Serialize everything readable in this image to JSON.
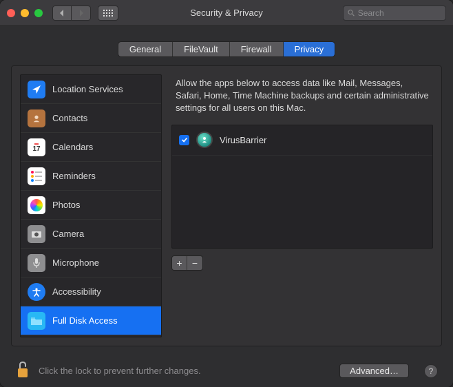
{
  "window": {
    "title": "Security & Privacy"
  },
  "search": {
    "placeholder": "Search"
  },
  "tabs": [
    {
      "label": "General",
      "active": false
    },
    {
      "label": "FileVault",
      "active": false
    },
    {
      "label": "Firewall",
      "active": false
    },
    {
      "label": "Privacy",
      "active": true
    }
  ],
  "sidebar": {
    "items": [
      {
        "label": "Location Services",
        "icon": "location",
        "selected": false
      },
      {
        "label": "Contacts",
        "icon": "contacts",
        "selected": false
      },
      {
        "label": "Calendars",
        "icon": "calendar",
        "selected": false
      },
      {
        "label": "Reminders",
        "icon": "reminders",
        "selected": false
      },
      {
        "label": "Photos",
        "icon": "photos",
        "selected": false
      },
      {
        "label": "Camera",
        "icon": "camera",
        "selected": false
      },
      {
        "label": "Microphone",
        "icon": "microphone",
        "selected": false
      },
      {
        "label": "Accessibility",
        "icon": "accessibility",
        "selected": false
      },
      {
        "label": "Full Disk Access",
        "icon": "folder",
        "selected": true
      }
    ]
  },
  "content": {
    "description": "Allow the apps below to access data like Mail, Messages, Safari, Home, Time Machine backups and certain administrative settings for all users on this Mac.",
    "apps": [
      {
        "name": "VirusBarrier",
        "checked": true
      }
    ]
  },
  "footer": {
    "lock_text": "Click the lock to prevent further changes.",
    "advanced_label": "Advanced…",
    "help_label": "?"
  }
}
